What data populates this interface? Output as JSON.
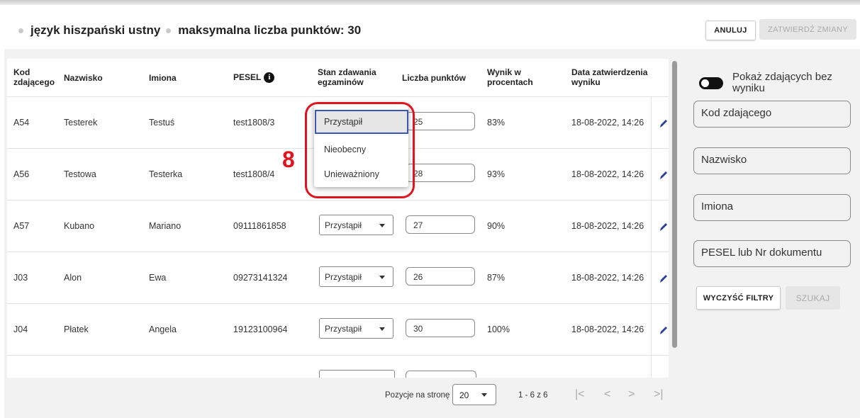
{
  "header": {
    "subject": "język hiszpański ustny",
    "max_points": "maksymalna liczba punktów: 30",
    "cancel_label": "ANULUJ",
    "confirm_label": "ZATWIERDŹ ZMIANY"
  },
  "table": {
    "columns": {
      "code": "Kod zdającego",
      "surname": "Nazwisko",
      "names": "Imiona",
      "pesel": "PESEL",
      "status": "Stan zdawania egzaminów",
      "points": "Liczba punktów",
      "percent": "Wynik w procentach",
      "date": "Data zatwierdzenia wyniku"
    },
    "info_icon": "info-icon",
    "rows": [
      {
        "code": "A54",
        "surname": "Testerek",
        "names": "Testuś",
        "pesel": "test1808/3",
        "status": "Przystąpił",
        "points": "25",
        "percent": "83%",
        "date": "18-08-2022, 14:26"
      },
      {
        "code": "A56",
        "surname": "Testowa",
        "names": "Testerka",
        "pesel": "test1808/4",
        "status": "Przystąpił",
        "points": "28",
        "percent": "93%",
        "date": "18-08-2022, 14:26"
      },
      {
        "code": "A57",
        "surname": "Kubano",
        "names": "Mariano",
        "pesel": "09111861858",
        "status": "Przystąpił",
        "points": "27",
        "percent": "90%",
        "date": "18-08-2022, 14:26"
      },
      {
        "code": "J03",
        "surname": "Alon",
        "names": "Ewa",
        "pesel": "09273141324",
        "status": "Przystąpił",
        "points": "26",
        "percent": "87%",
        "date": "18-08-2022, 14:26"
      },
      {
        "code": "J04",
        "surname": "Płatek",
        "names": "Angela",
        "pesel": "19123100964",
        "status": "Przystąpił",
        "points": "30",
        "percent": "100%",
        "date": "18-08-2022, 14:26"
      }
    ]
  },
  "dropdown": {
    "options": [
      "Przystąpił",
      "Nieobecny",
      "Unieważniony"
    ],
    "selected": "Przystąpił"
  },
  "annotation": {
    "marker": "8",
    "color": "#e0141e"
  },
  "filters": {
    "toggle_label": "Pokaż zdających bez wyniku",
    "code_placeholder": "Kod zdającego",
    "surname_placeholder": "Nazwisko",
    "names_placeholder": "Imiona",
    "pesel_placeholder": "PESEL lub Nr dokumentu",
    "clear_label": "WYCZYŚĆ FILTRY",
    "search_label": "SZUKAJ"
  },
  "pagination": {
    "per_page_label": "Pozycje na stronę",
    "per_page_value": "20",
    "range": "1 - 6 z 6"
  },
  "colors": {
    "accent": "#3f57b3",
    "pencil": "#2a3f9a",
    "panel_bg": "#f2f2f2"
  }
}
